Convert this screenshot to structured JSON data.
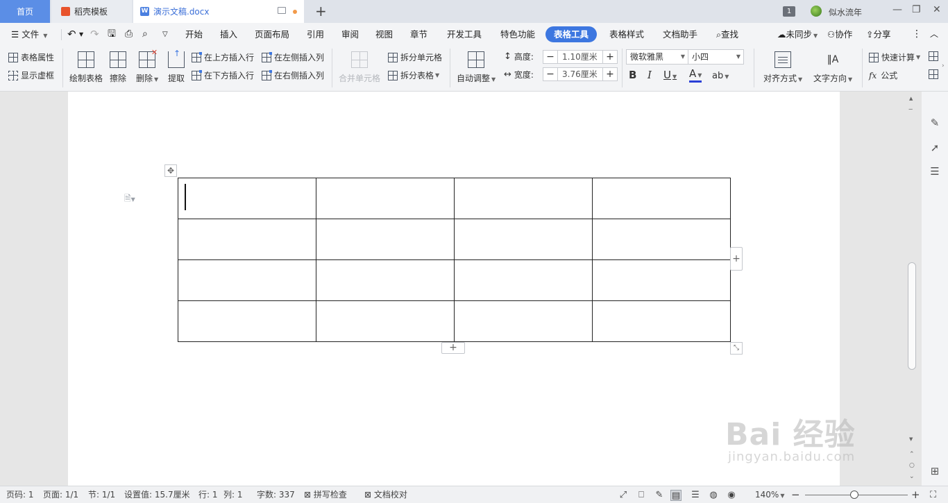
{
  "tabs": {
    "home": "首页",
    "template": "稻壳模板",
    "document": "演示文稿.docx",
    "add": "+"
  },
  "window": {
    "badge": "1",
    "user": "似水流年",
    "minimize": "—",
    "restore": "❐",
    "close": "✕"
  },
  "menu": {
    "file": "文件",
    "items": [
      "开始",
      "插入",
      "页面布局",
      "引用",
      "审阅",
      "视图",
      "章节",
      "开发工具",
      "特色功能"
    ],
    "active": "表格工具",
    "after": [
      "表格样式",
      "文档助手"
    ],
    "search": "查找",
    "sync": "未同步",
    "collab": "协作",
    "share": "分享"
  },
  "ribbon": {
    "table_props": "表格属性",
    "show_grid": "显示虚框",
    "draw_table": "绘制表格",
    "erase": "擦除",
    "delete": "删除",
    "extract": "提取",
    "insert_above": "在上方插入行",
    "insert_below": "在下方插入行",
    "insert_left": "在左侧插入列",
    "insert_right": "在右侧插入列",
    "merge_cells": "合并单元格",
    "split_cells": "拆分单元格",
    "split_table": "拆分表格",
    "auto_fit": "自动调整",
    "height_label": "高度:",
    "height_value": "1.10厘米",
    "width_label": "宽度:",
    "width_value": "3.76厘米",
    "font_name": "微软雅黑",
    "font_size": "小四",
    "align": "对齐方式",
    "text_direction": "文字方向",
    "quick_calc": "快速计算",
    "formula": "公式"
  },
  "table": {
    "rows": 4,
    "cols": 4,
    "cells": [
      [
        "",
        "",
        "",
        ""
      ],
      [
        "",
        "",
        "",
        ""
      ],
      [
        "",
        "",
        "",
        ""
      ],
      [
        "",
        "",
        "",
        ""
      ]
    ]
  },
  "status": {
    "page_no": "页码: 1",
    "pages": "页面: 1/1",
    "section": "节: 1/1",
    "setting": "设置值: 15.7厘米",
    "row": "行: 1",
    "col": "列: 1",
    "word_count": "字数: 337",
    "spell_check": "拼写检查",
    "doc_proof": "文档校对",
    "zoom": "140%",
    "zoom_progress": 0.48
  },
  "watermark": {
    "main": "Bai 经验",
    "sub": "jingyan.baidu.com"
  },
  "colors": {
    "accent": "#3d77e0",
    "home_tab": "#5b8ee6",
    "unsaved_dot": "#f29a4a"
  }
}
